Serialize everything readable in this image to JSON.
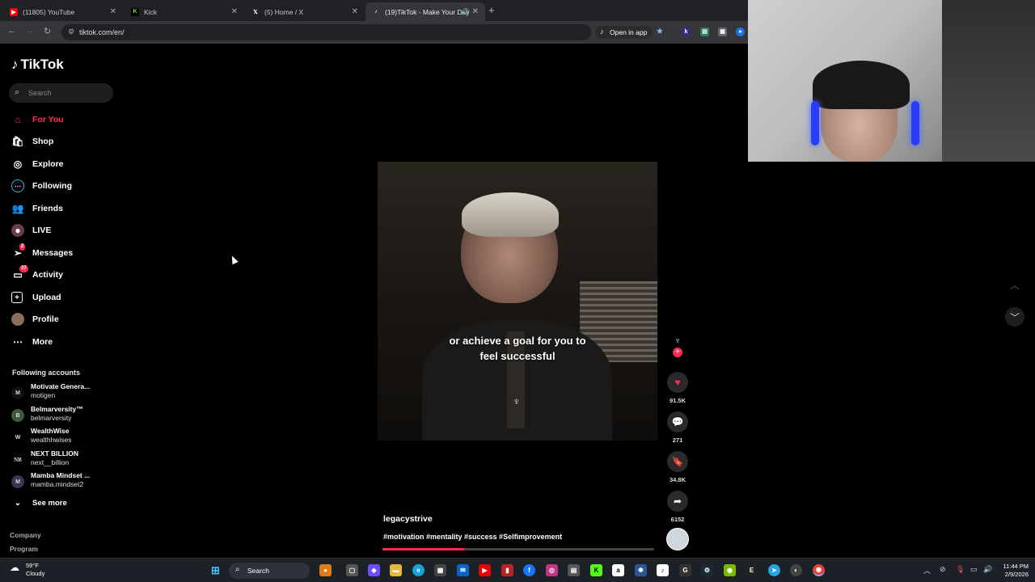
{
  "browser": {
    "tabs": [
      {
        "title": "(11805) YouTube",
        "icon": "youtube-icon",
        "color": "#ff0000"
      },
      {
        "title": "Kick",
        "icon": "kick-icon",
        "color": "#53fc18"
      },
      {
        "title": "(5) Home / X",
        "icon": "x-icon",
        "color": "#ffffff"
      },
      {
        "title": "(19)TikTok - Make Your Day",
        "icon": "tiktok-icon",
        "color": "#ffffff",
        "active": true
      }
    ],
    "new_tab": "+",
    "url": "tiktok.com/en/",
    "open_in_app": "Open in app"
  },
  "sidebar": {
    "logo": "TikTok",
    "search_placeholder": "Search",
    "items": [
      {
        "label": "For You",
        "icon": "home-icon",
        "active": true
      },
      {
        "label": "Shop",
        "icon": "shop-icon"
      },
      {
        "label": "Explore",
        "icon": "compass-icon"
      },
      {
        "label": "Following",
        "icon": "following-icon"
      },
      {
        "label": "Friends",
        "icon": "friends-icon"
      },
      {
        "label": "LIVE",
        "icon": "live-icon"
      },
      {
        "label": "Messages",
        "icon": "paper-plane-icon",
        "badge": "2"
      },
      {
        "label": "Activity",
        "icon": "inbox-icon",
        "badge": "37"
      },
      {
        "label": "Upload",
        "icon": "upload-icon"
      },
      {
        "label": "Profile",
        "icon": "avatar-icon"
      },
      {
        "label": "More",
        "icon": "more-icon"
      }
    ],
    "following_title": "Following accounts",
    "accounts": [
      {
        "name": "Motivate Genera...",
        "handle": "motigen",
        "avatar": "M"
      },
      {
        "name": "Belmarversity™",
        "handle": "belmarversity",
        "avatar": "B"
      },
      {
        "name": "WealthWise",
        "handle": "wealthhwises",
        "avatar": "W"
      },
      {
        "name": "NEXT BILLION",
        "handle": "next__billion",
        "avatar": "NB"
      },
      {
        "name": "Mamba Mindset ...",
        "handle": "mamba.mindset2",
        "avatar": "M"
      }
    ],
    "see_more": "See more",
    "footer": [
      "Company",
      "Program"
    ]
  },
  "video": {
    "caption_line1": "or achieve a goal for you to",
    "caption_line2": "feel successful",
    "author": "legacystrive",
    "hashtags": "#motivation #mentality #success #Selfimprovement",
    "progress": 0.3,
    "likes": "91.5K",
    "comments": "271",
    "saves": "34.8K",
    "shares": "6152"
  },
  "taskbar": {
    "temperature": "59°F",
    "weather": "Cloudy",
    "search": "Search",
    "time": "11:44 PM",
    "date": "2/9/2026"
  }
}
